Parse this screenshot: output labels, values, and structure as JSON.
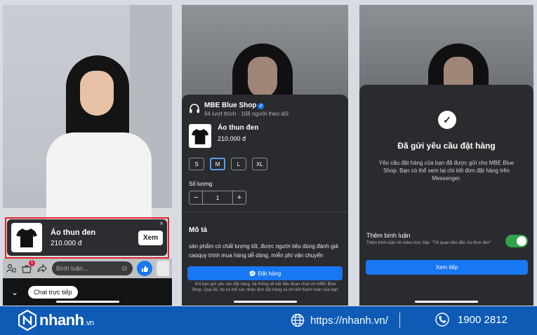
{
  "panel1": {
    "product_card": {
      "name": "Áo thun đen",
      "price": "210.000 đ",
      "view_label": "Xem",
      "close": "×"
    },
    "comment_placeholder": "Bình luận...",
    "live_chat_label": "Chat trực tiếp",
    "notification_count": "1"
  },
  "panel2": {
    "shop": {
      "name": "MBE Blue Shop",
      "meta": "94  lượt thích · 168  người theo dõi"
    },
    "product": {
      "name": "Áo thun đen",
      "price": "210.000 đ"
    },
    "sizes": [
      "S",
      "M",
      "L",
      "XL"
    ],
    "selected_size": "M",
    "quantity_label": "Số lượng",
    "quantity": {
      "minus": "−",
      "value": "1",
      "plus": "+"
    },
    "description_title": "Mô tả",
    "description_text": "sản phẩm có chất lượng tốt, được người tiêu dùng đánh giá caoquy trình mua hàng dễ dàng, miễn phí vận chuyển",
    "order_button": "Đặt hàng",
    "fine_print": "Khi bạn gửi yêu cầu đặt hàng, hệ thống sẽ bắt đầu đoạn chat với MBE Blue Shop. Qua đó, họ có thể xác nhận đơn đặt hàng và chi tiết thanh toán của bạn."
  },
  "panel3": {
    "title": "Đã gửi yêu cầu đặt hàng",
    "message": "Yêu cầu đặt hàng của bạn đã được gửi cho MBE Blue Shop. Bạn có thể xem lại chi tiết đơn đặt hàng trên Messenger.",
    "comment_title": "Thêm bình luận",
    "comment_sub": "Thêm bình luận về video trực tiếp: \"Tôi quan tâm đến Áo thun đen\"",
    "toggle_on": true,
    "next_button": "Xem tiếp"
  },
  "footer": {
    "brand": "nhanh",
    "brand_suffix": ".vn",
    "website": "https://nhanh.vn/",
    "hotline": "1900 2812"
  },
  "colors": {
    "accent": "#1877f2",
    "footer": "#0e5bb5",
    "highlight": "#e0242c",
    "toggle": "#31a24c"
  }
}
